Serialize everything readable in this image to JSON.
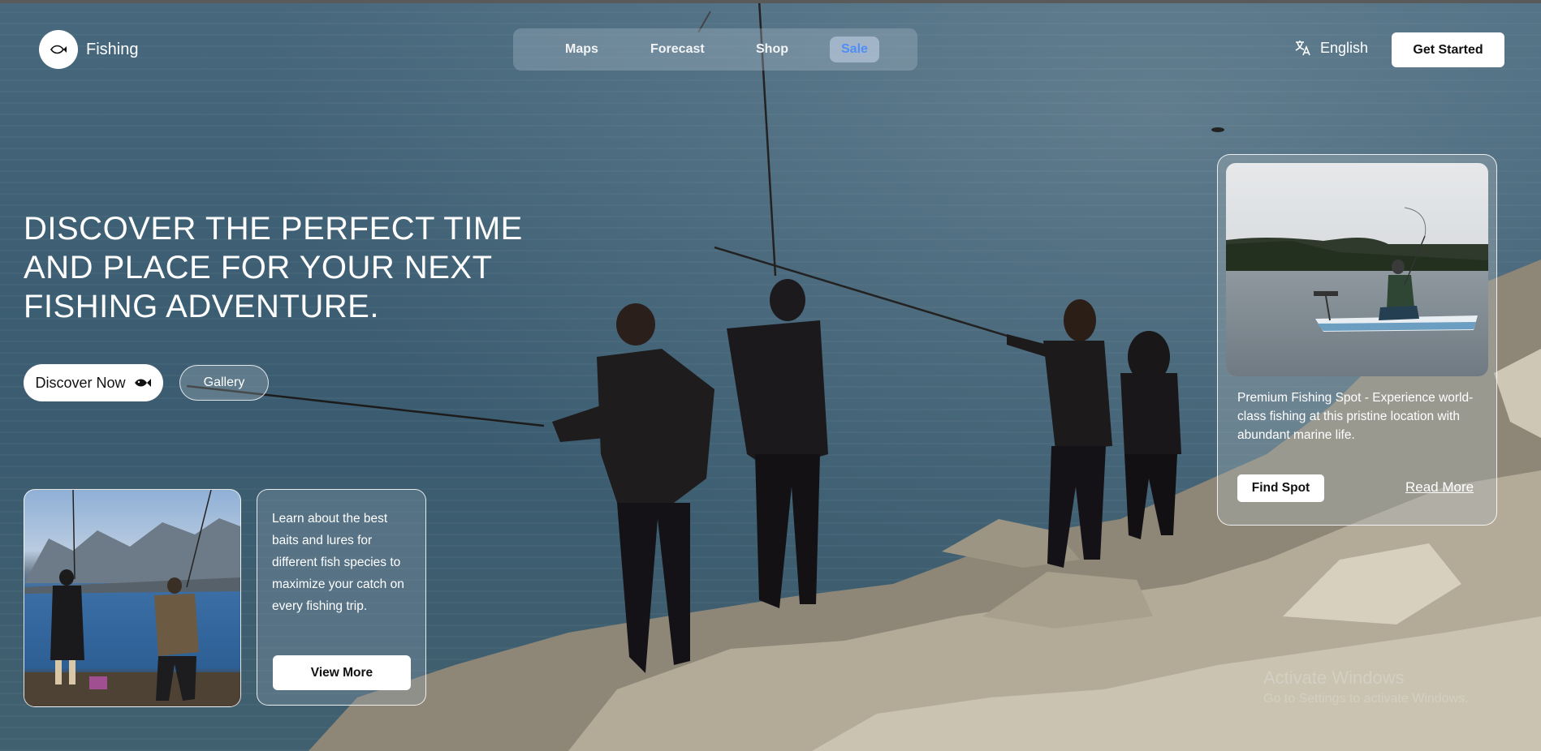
{
  "brand": {
    "name": "Fishing",
    "logo_icon": "fish-icon"
  },
  "nav": {
    "items": [
      {
        "label": "Maps"
      },
      {
        "label": "Forecast"
      },
      {
        "label": "Shop"
      },
      {
        "label": "Sale"
      }
    ],
    "active": "Sale",
    "active_color": "#4f8ef7"
  },
  "language": {
    "label": "English",
    "icon": "translate-icon"
  },
  "cta": {
    "get_started": "Get Started"
  },
  "hero": {
    "title": "DISCOVER THE PERFECT TIME AND PLACE FOR YOUR NEXT FISHING ADVENTURE.",
    "discover_label": "Discover Now",
    "discover_icon": "fish-icon",
    "gallery_label": "Gallery"
  },
  "info_card": {
    "text": "Learn about the best baits and lures for different fish species to maximize your catch on every fishing trip.",
    "button": "View More"
  },
  "spot_card": {
    "text": "Premium Fishing Spot - Experience world-class fishing at this pristine location with abundant marine life.",
    "find_button": "Find Spot",
    "read_more": "Read More"
  },
  "watermark": {
    "line1": "Activate Windows",
    "line2": "Go to Settings to activate Windows."
  }
}
